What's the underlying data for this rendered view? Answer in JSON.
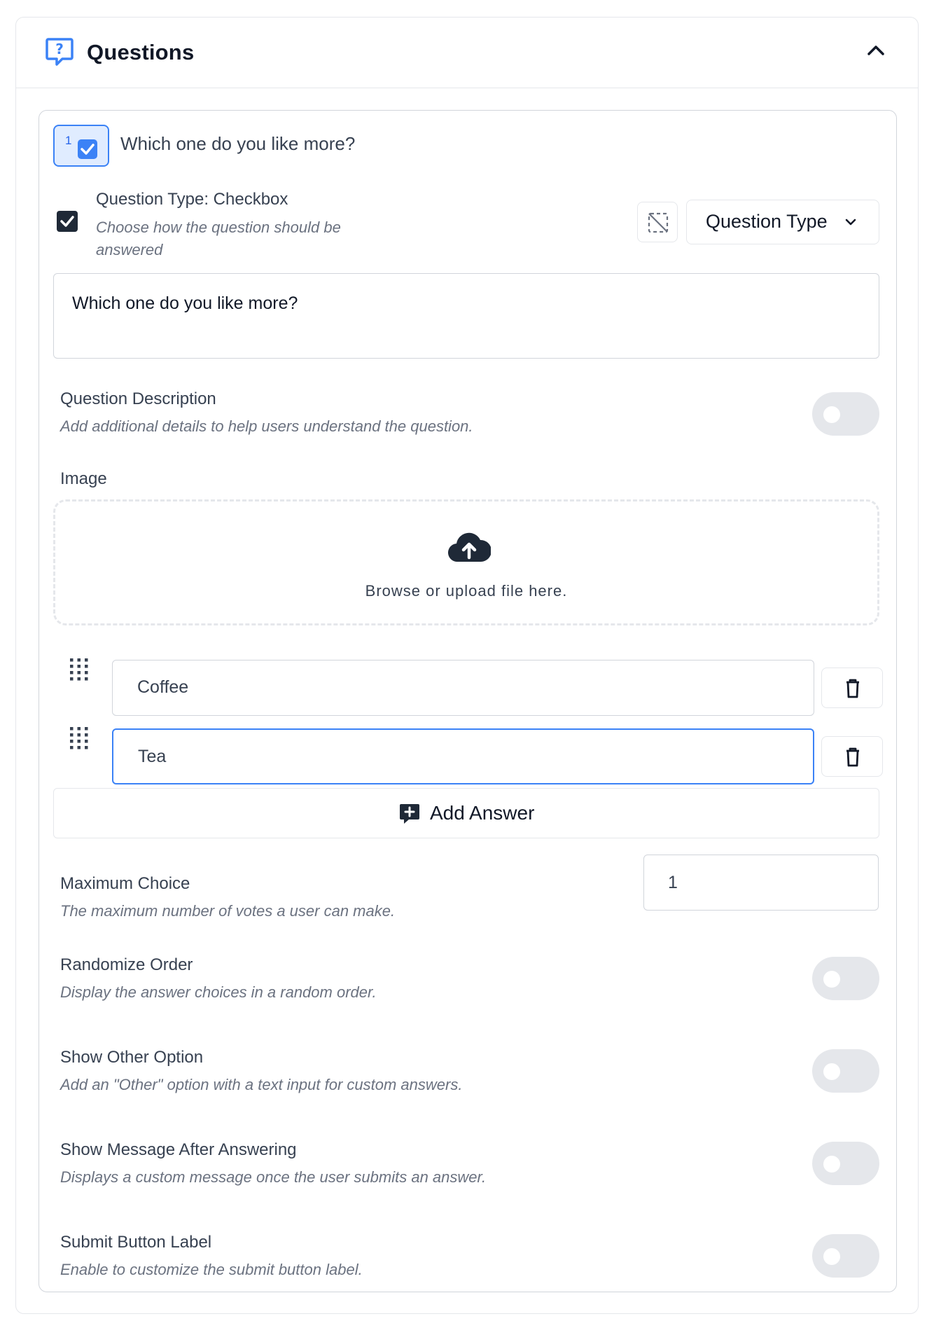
{
  "panel": {
    "title": "Questions",
    "icon": "question-chat-icon",
    "collapse_icon": "chevron-up-icon",
    "accent_color": "#3b82f6"
  },
  "question": {
    "number": "1",
    "title": "Which one do you like more?",
    "type_label": "Question Type: Checkbox",
    "type_help": "Choose how the question should be answered",
    "type_dropdown_label": "Question Type",
    "text_value": "Which one do you like more?"
  },
  "description_row": {
    "title": "Question Description",
    "help": "Add additional details to help users understand the question.",
    "enabled": false
  },
  "image": {
    "label": "Image",
    "upload_text": "Browse or upload file here."
  },
  "answers": [
    {
      "value": "Coffee",
      "focused": false
    },
    {
      "value": "Tea",
      "focused": true
    }
  ],
  "add_answer_label": "Add Answer",
  "max_choice": {
    "title": "Maximum Choice",
    "help": "The maximum number of votes a user can make.",
    "value": "1"
  },
  "settings": [
    {
      "title": "Randomize Order",
      "help": "Display the answer choices in a random order.",
      "enabled": false
    },
    {
      "title": "Show Other Option",
      "help": "Add an \"Other\" option with a text input for custom answers.",
      "enabled": false
    },
    {
      "title": "Show Message After Answering",
      "help": "Displays a custom message once the user submits an answer.",
      "enabled": false
    },
    {
      "title": "Submit Button Label",
      "help": "Enable to customize the submit button label.",
      "enabled": false
    }
  ]
}
